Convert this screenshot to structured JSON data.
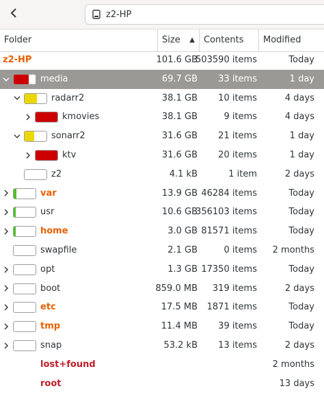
{
  "toolbar": {
    "back_icon": "chevron-left-icon",
    "drive_icon": "drive-icon",
    "path_label": "z2-HP"
  },
  "columns": {
    "folder": "Folder",
    "size": "Size",
    "contents": "Contents",
    "modified": "Modified",
    "sort_indicator": "▲"
  },
  "colors": {
    "red_fill": "#cc0000",
    "yellow_fill": "#ecd700",
    "green_fill": "#4ec126",
    "orange_text": "#e66100",
    "red_text": "#c01c28",
    "selected_row": "#9a9996"
  },
  "rows": [
    {
      "name": "z2-HP",
      "size": "101.6 GB",
      "contents": "503590 items",
      "modified": "Today",
      "level": 0,
      "expander": "",
      "usage": null,
      "usage_color": "",
      "style": "root",
      "selected": false
    },
    {
      "name": "media",
      "size": "69.7 GB",
      "contents": "33 items",
      "modified": "1 day",
      "level": 0,
      "expander": "expanded",
      "usage": 0.69,
      "usage_color": "red",
      "style": "normal",
      "selected": true
    },
    {
      "name": "radarr2",
      "size": "38.1 GB",
      "contents": "10 items",
      "modified": "4 days",
      "level": 1,
      "expander": "expanded",
      "usage": 0.55,
      "usage_color": "yellow",
      "style": "normal",
      "selected": false
    },
    {
      "name": "kmovies",
      "size": "38.1 GB",
      "contents": "9 items",
      "modified": "4 days",
      "level": 2,
      "expander": "collapsed",
      "usage": 1.0,
      "usage_color": "red",
      "style": "normal",
      "selected": false
    },
    {
      "name": "sonarr2",
      "size": "31.6 GB",
      "contents": "21 items",
      "modified": "1 day",
      "level": 1,
      "expander": "expanded",
      "usage": 0.45,
      "usage_color": "yellow",
      "style": "normal",
      "selected": false
    },
    {
      "name": "ktv",
      "size": "31.6 GB",
      "contents": "20 items",
      "modified": "1 day",
      "level": 2,
      "expander": "collapsed",
      "usage": 1.0,
      "usage_color": "red",
      "style": "normal",
      "selected": false
    },
    {
      "name": "z2",
      "size": "4.1 kB",
      "contents": "1 item",
      "modified": "2 days",
      "level": 1,
      "expander": "",
      "usage": 0.0,
      "usage_color": "red",
      "style": "normal",
      "selected": false
    },
    {
      "name": "var",
      "size": "13.9 GB",
      "contents": "46284 items",
      "modified": "Today",
      "level": 0,
      "expander": "collapsed",
      "usage": 0.137,
      "usage_color": "green",
      "style": "orange",
      "selected": false
    },
    {
      "name": "usr",
      "size": "10.6 GB",
      "contents": "356103 items",
      "modified": "Today",
      "level": 0,
      "expander": "collapsed",
      "usage": 0.104,
      "usage_color": "green",
      "style": "normal",
      "selected": false
    },
    {
      "name": "home",
      "size": "3.0 GB",
      "contents": "81571 items",
      "modified": "Today",
      "level": 0,
      "expander": "collapsed",
      "usage": 0.03,
      "usage_color": "green",
      "style": "orange",
      "selected": false
    },
    {
      "name": "swapfile",
      "size": "2.1 GB",
      "contents": "0 items",
      "modified": "2 months",
      "level": 0,
      "expander": "",
      "usage": 0.0,
      "usage_color": "green",
      "style": "normal",
      "selected": false
    },
    {
      "name": "opt",
      "size": "1.3 GB",
      "contents": "17350 items",
      "modified": "Today",
      "level": 0,
      "expander": "collapsed",
      "usage": 0.0,
      "usage_color": "green",
      "style": "normal",
      "selected": false
    },
    {
      "name": "boot",
      "size": "859.0 MB",
      "contents": "319 items",
      "modified": "2 days",
      "level": 0,
      "expander": "collapsed",
      "usage": 0.0,
      "usage_color": "green",
      "style": "normal",
      "selected": false
    },
    {
      "name": "etc",
      "size": "17.5 MB",
      "contents": "1871 items",
      "modified": "Today",
      "level": 0,
      "expander": "collapsed",
      "usage": 0.0,
      "usage_color": "green",
      "style": "orange",
      "selected": false
    },
    {
      "name": "tmp",
      "size": "11.4 MB",
      "contents": "39 items",
      "modified": "Today",
      "level": 0,
      "expander": "collapsed",
      "usage": 0.0,
      "usage_color": "green",
      "style": "orange",
      "selected": false
    },
    {
      "name": "snap",
      "size": "53.2 kB",
      "contents": "13 items",
      "modified": "2 days",
      "level": 0,
      "expander": "collapsed",
      "usage": 0.0,
      "usage_color": "green",
      "style": "normal",
      "selected": false
    },
    {
      "name": "lost+found",
      "size": "",
      "contents": "",
      "modified": "2 months",
      "level": 0,
      "expander": "",
      "usage": null,
      "usage_color": "",
      "style": "red",
      "selected": false
    },
    {
      "name": "root",
      "size": "",
      "contents": "",
      "modified": "13 days",
      "level": 0,
      "expander": "",
      "usage": null,
      "usage_color": "",
      "style": "red",
      "selected": false
    }
  ]
}
